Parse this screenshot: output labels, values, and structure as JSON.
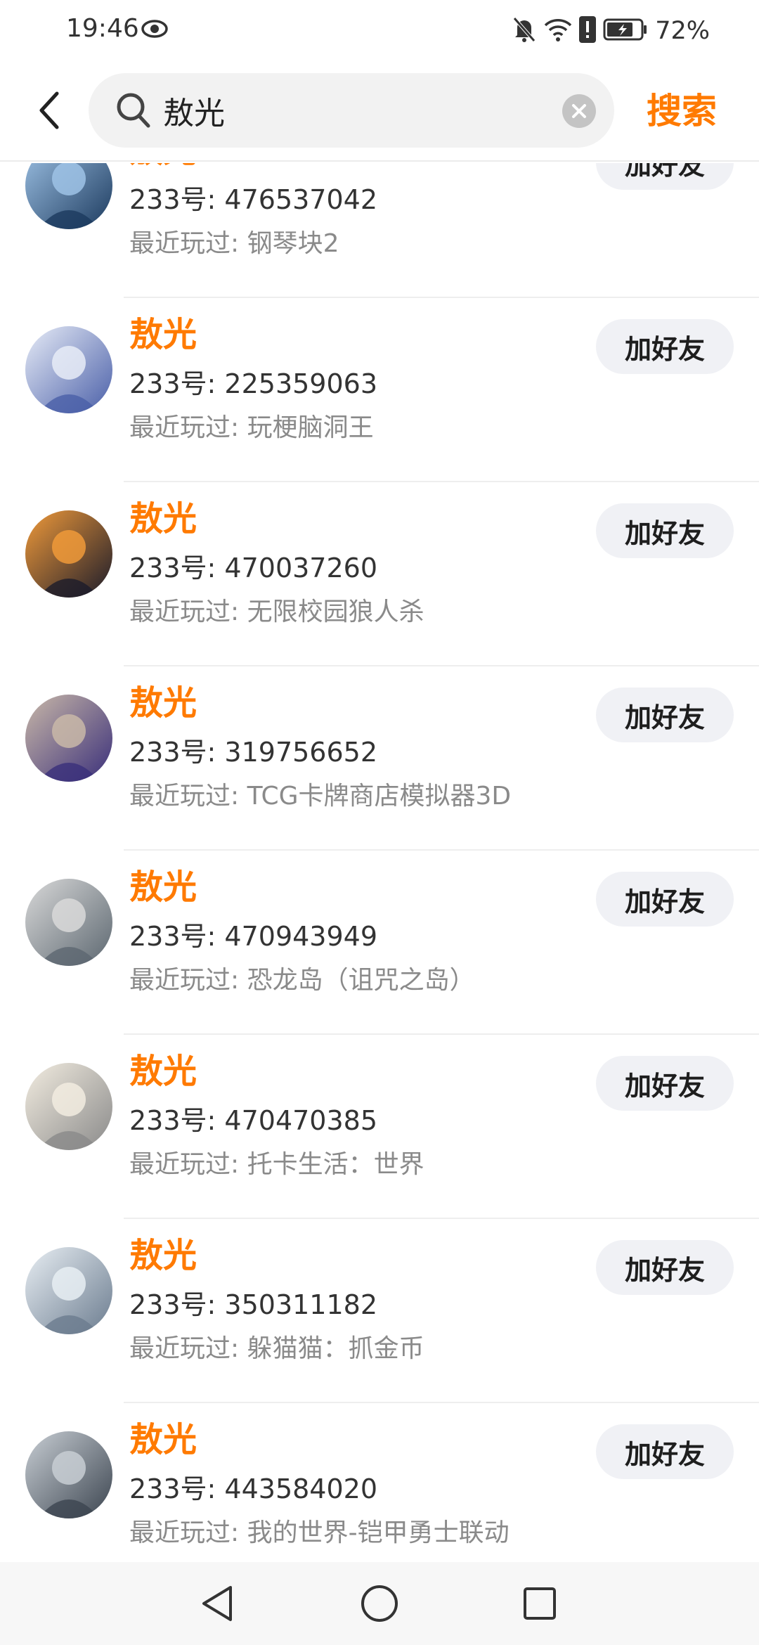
{
  "status_bar": {
    "time": "19:46",
    "battery_percent": "72%",
    "icons": [
      "eye-icon",
      "mute-bell-icon",
      "wifi-icon",
      "alert-icon",
      "battery-icon"
    ]
  },
  "search": {
    "query": "敖光",
    "button_label": "搜索"
  },
  "results": [
    {
      "name": "敖光",
      "uid": "233号: 476537042",
      "recent": "最近玩过: 钢琴块2",
      "add_label": "加好友",
      "avatar_colors": [
        "#1c3a5e",
        "#9fc3e6"
      ]
    },
    {
      "name": "敖光",
      "uid": "233号: 225359063",
      "recent": "最近玩过: 玩梗脑洞王",
      "add_label": "加好友",
      "avatar_colors": [
        "#4a5fa8",
        "#e7ecf7"
      ]
    },
    {
      "name": "敖光",
      "uid": "233号: 470037260",
      "recent": "最近玩过: 无限校园狼人杀",
      "add_label": "加好友",
      "avatar_colors": [
        "#1b1b2a",
        "#f09a3a"
      ]
    },
    {
      "name": "敖光",
      "uid": "233号: 319756652",
      "recent": "最近玩过: TCG卡牌商店模拟器3D",
      "add_label": "加好友",
      "avatar_colors": [
        "#3a2f7a",
        "#c9b8a8"
      ]
    },
    {
      "name": "敖光",
      "uid": "233号: 470943949",
      "recent": "最近玩过: 恐龙岛（诅咒之岛）",
      "add_label": "加好友",
      "avatar_colors": [
        "#5c6770",
        "#d9d9d9"
      ]
    },
    {
      "name": "敖光",
      "uid": "233号: 470470385",
      "recent": "最近玩过: 托卡生活：世界",
      "add_label": "加好友",
      "avatar_colors": [
        "#8a8a8a",
        "#f2ece0"
      ]
    },
    {
      "name": "敖光",
      "uid": "233号: 350311182",
      "recent": "最近玩过: 躲猫猫：抓金币",
      "add_label": "加好友",
      "avatar_colors": [
        "#6b7c8f",
        "#e8eef3"
      ]
    },
    {
      "name": "敖光",
      "uid": "233号: 443584020",
      "recent": "最近玩过: 我的世界-铠甲勇士联动",
      "add_label": "加好友",
      "avatar_colors": [
        "#3c4550",
        "#c8ced4"
      ]
    }
  ],
  "colors": {
    "accent": "#ff7a00",
    "button_bg": "#f0f1f5",
    "secondary_text": "#8a8a8a"
  }
}
